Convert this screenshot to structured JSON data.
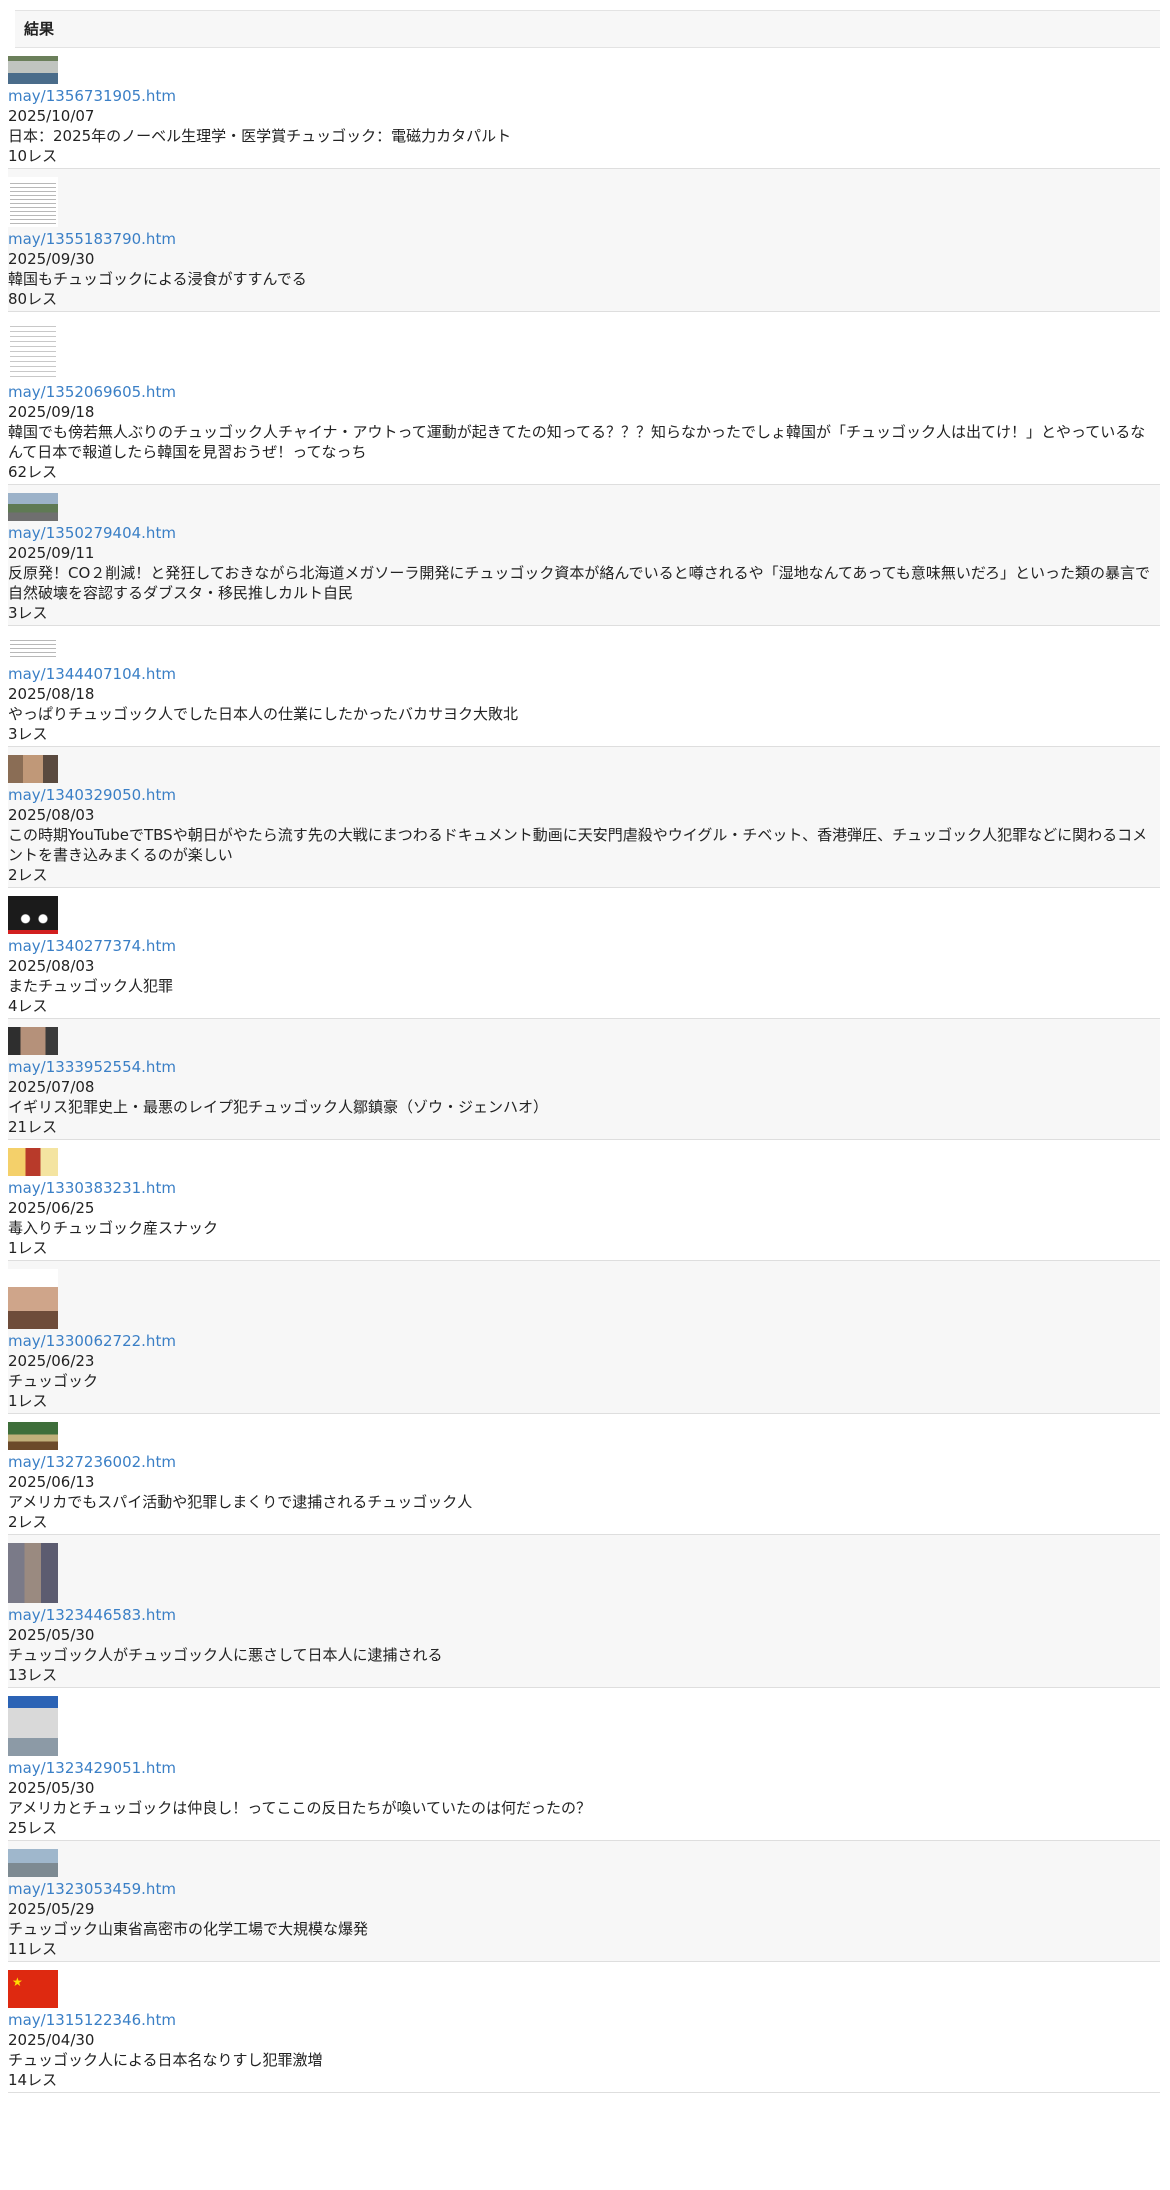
{
  "results": {
    "header": "結果",
    "items": [
      {
        "thumb": "map-thumbnail",
        "link": "may/1356731905.htm",
        "date": "2025/10/07",
        "title": "日本：2025年のノーベル生理学・医学賞チュッゴック：電磁力カタパルト",
        "count": "10レス"
      },
      {
        "thumb": "document-thumbnail",
        "link": "may/1355183790.htm",
        "date": "2025/09/30",
        "title": "韓国もチュッゴックによる浸食がすすんでる",
        "count": "80レス"
      },
      {
        "thumb": "document-thumbnail",
        "link": "may/1352069605.htm",
        "date": "2025/09/18",
        "title": "韓国でも傍若無人ぶりのチュッゴック人チャイナ・アウトって運動が起きてたの知ってる？？？知らなかったでしょ韓国が「チュッゴック人は出てけ！」とやっているなんて日本で報道したら韓国を見習おうぜ！ってなっち",
        "count": "62レス"
      },
      {
        "thumb": "landscape-thumbnail",
        "link": "may/1350279404.htm",
        "date": "2025/09/11",
        "title": "反原発！CO２削減！と発狂しておきながら北海道メガソーラ開発にチュッゴック資本が絡んでいると噂されるや「湿地なんてあっても意味無いだろ」といった類の暴言で自然破壊を容認するダブスタ・移民推しカルト自民",
        "count": "3レス"
      },
      {
        "thumb": "document-thumbnail",
        "link": "may/1344407104.htm",
        "date": "2025/08/18",
        "title": "やっぱりチュッゴック人でした日本人の仕業にしたかったバカサヨク大敗北",
        "count": "3レス"
      },
      {
        "thumb": "person-thumbnail",
        "link": "may/1340329050.htm",
        "date": "2025/08/03",
        "title": "この時期YouTubeでTBSや朝日がやたら流す先の大戦にまつわるドキュメント動画に天安門虐殺やウイグル・チベット、香港弾圧、チュッゴック人犯罪などに関わるコメントを書き込みまくるのが楽しい",
        "count": "2レス"
      },
      {
        "thumb": "night-scene-thumbnail",
        "link": "may/1340277374.htm",
        "date": "2025/08/03",
        "title": "またチュッゴック人犯罪",
        "count": "4レス"
      },
      {
        "thumb": "person-thumbnail",
        "link": "may/1333952554.htm",
        "date": "2025/07/08",
        "title": "イギリス犯罪史上・最悪のレイプ犯チュッゴック人鄒鎮豪（ゾウ・ジェンハオ）",
        "count": "21レス"
      },
      {
        "thumb": "snack-thumbnail",
        "link": "may/1330383231.htm",
        "date": "2025/06/25",
        "title": "毒入りチュッゴック産スナック",
        "count": "1レス"
      },
      {
        "thumb": "person-thumbnail",
        "link": "may/1330062722.htm",
        "date": "2025/06/23",
        "title": "チュッゴック",
        "count": "1レス"
      },
      {
        "thumb": "food-thumbnail",
        "link": "may/1327236002.htm",
        "date": "2025/06/13",
        "title": "アメリカでもスパイ活動や犯罪しまくりで逮捕されるチュッゴック人",
        "count": "2レス"
      },
      {
        "thumb": "group-thumbnail",
        "link": "may/1323446583.htm",
        "date": "2025/05/30",
        "title": "チュッゴック人がチュッゴック人に悪さして日本人に逮捕される",
        "count": "13レス"
      },
      {
        "thumb": "building-thumbnail",
        "link": "may/1323429051.htm",
        "date": "2025/05/30",
        "title": "アメリカとチュッゴックは仲良し！ってここの反日たちが喚いていたのは何だったの？",
        "count": "25レス"
      },
      {
        "thumb": "smoke-thumbnail",
        "link": "may/1323053459.htm",
        "date": "2025/05/29",
        "title": "チュッゴック山東省高密市の化学工場で大規模な爆発",
        "count": "11レス"
      },
      {
        "thumb": "flag-thumbnail",
        "link": "may/1315122346.htm",
        "date": "2025/04/30",
        "title": "チュッゴック人による日本名なりすし犯罪激増",
        "count": "14レス"
      }
    ]
  },
  "colors": {
    "link": "#3a7fc6",
    "alt_row_bg": "#f7f7f7",
    "border": "#dedede"
  }
}
